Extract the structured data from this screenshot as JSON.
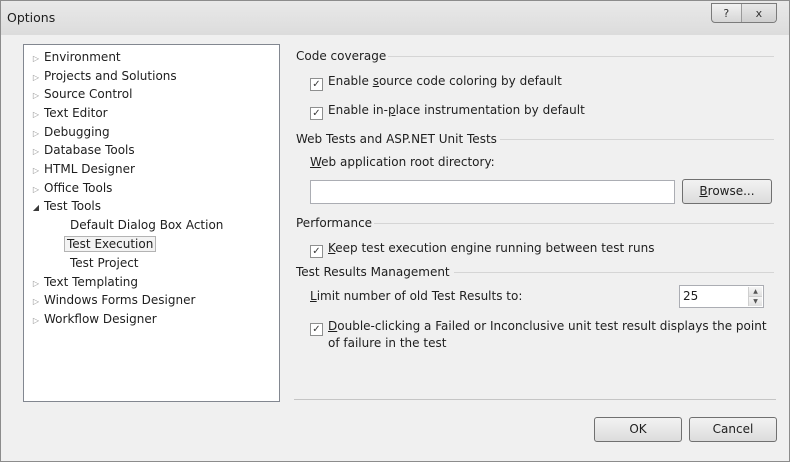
{
  "window": {
    "title": "Options",
    "help_label": "?",
    "close_label": "x"
  },
  "tree": {
    "items": [
      {
        "label": "Environment"
      },
      {
        "label": "Projects and Solutions"
      },
      {
        "label": "Source Control"
      },
      {
        "label": "Text Editor"
      },
      {
        "label": "Debugging"
      },
      {
        "label": "Database Tools"
      },
      {
        "label": "HTML Designer"
      },
      {
        "label": "Office Tools"
      },
      {
        "label": "Test Tools",
        "expanded": true,
        "children": [
          {
            "label": "Default Dialog Box Action"
          },
          {
            "label": "Test Execution",
            "selected": true
          },
          {
            "label": "Test Project"
          }
        ]
      },
      {
        "label": "Text Templating"
      },
      {
        "label": "Windows Forms Designer"
      },
      {
        "label": "Workflow Designer"
      }
    ]
  },
  "panel": {
    "code_coverage": {
      "header": "Code coverage",
      "coloring": {
        "pre": "Enable ",
        "key": "s",
        "post": "ource code coloring by default",
        "checked": true
      },
      "instrumentation": {
        "pre": "Enable in-",
        "key": "p",
        "post": "lace instrumentation by default",
        "checked": true
      }
    },
    "web_tests": {
      "header": "Web Tests and ASP.NET Unit Tests",
      "root_label": {
        "key": "W",
        "post": "eb application root directory:"
      },
      "root_value": "",
      "browse": {
        "key": "B",
        "post": "rowse..."
      }
    },
    "performance": {
      "header": "Performance",
      "keep_running": {
        "key": "K",
        "post": "eep test execution engine running between test runs",
        "checked": true
      }
    },
    "results": {
      "header": "Test Results Management",
      "limit_label": {
        "key": "L",
        "post": "imit number of old Test Results to:"
      },
      "limit_value": "25",
      "double_click": {
        "key": "D",
        "post1": "ouble-clicking a Failed or Inconclusive unit test result displays the point",
        "post2": "of failure in the test",
        "checked": true
      }
    }
  },
  "buttons": {
    "ok": "OK",
    "cancel": "Cancel"
  },
  "icons": {
    "collapsed": "▷",
    "expanded": "◢",
    "check": "✓"
  }
}
